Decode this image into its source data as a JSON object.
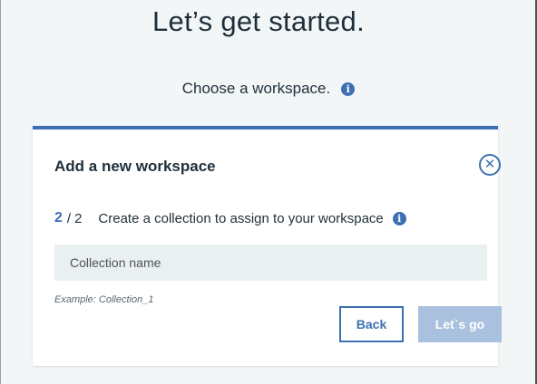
{
  "page": {
    "title": "Let’s get started.",
    "subtitle": "Choose a workspace."
  },
  "icons": {
    "info": "info-icon",
    "close": "close-icon",
    "info_glyph": "i",
    "close_glyph": "✕"
  },
  "card": {
    "title": "Add a new workspace",
    "step": {
      "current": "2",
      "separator": "/",
      "total": "2",
      "description": "Create a collection to assign to your workspace"
    },
    "collection_input": {
      "value": "",
      "placeholder": "Collection name"
    },
    "example": "Example: Collection_1",
    "back_label": "Back",
    "go_label": "Let`s go"
  },
  "colors": {
    "accent": "#3d70b2",
    "disabled_button": "#a9c0de",
    "background": "#f3f6f7",
    "input_background": "#eaeff2"
  }
}
